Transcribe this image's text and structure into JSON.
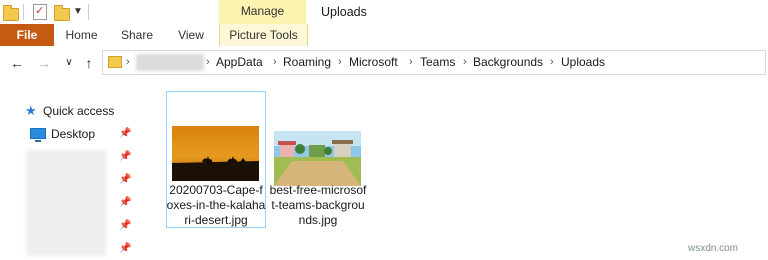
{
  "window": {
    "title": "Uploads",
    "contextual_group": "Manage"
  },
  "ribbon": {
    "tabs": [
      {
        "label": "File",
        "active": false
      },
      {
        "label": "Home",
        "active": false
      },
      {
        "label": "Share",
        "active": false
      },
      {
        "label": "View",
        "active": false
      },
      {
        "label": "Picture Tools",
        "active": false
      }
    ]
  },
  "nav_buttons": {
    "back": "←",
    "forward": "→",
    "recent": "∨",
    "up": "↑"
  },
  "address": {
    "breadcrumbs": [
      "AppData",
      "Roaming",
      "Microsoft",
      "Teams",
      "Backgrounds",
      "Uploads"
    ],
    "separator": "›"
  },
  "nav_pane": {
    "quick_access": "Quick access",
    "desktop": "Desktop",
    "pin_glyph": "📌"
  },
  "files": [
    {
      "name": "20200703-Cape-foxes-in-the-kalahari-desert.jpg",
      "selected": true
    },
    {
      "name": "best-free-microsoft-teams-backgrounds.jpg",
      "selected": false
    }
  ],
  "watermark": "wsxdn.com",
  "colors": {
    "file_tab": "#c55b12",
    "manage_context": "#fbf3b0",
    "selection_border": "#99d1ff",
    "quick_access_star": "#2b78d4"
  }
}
